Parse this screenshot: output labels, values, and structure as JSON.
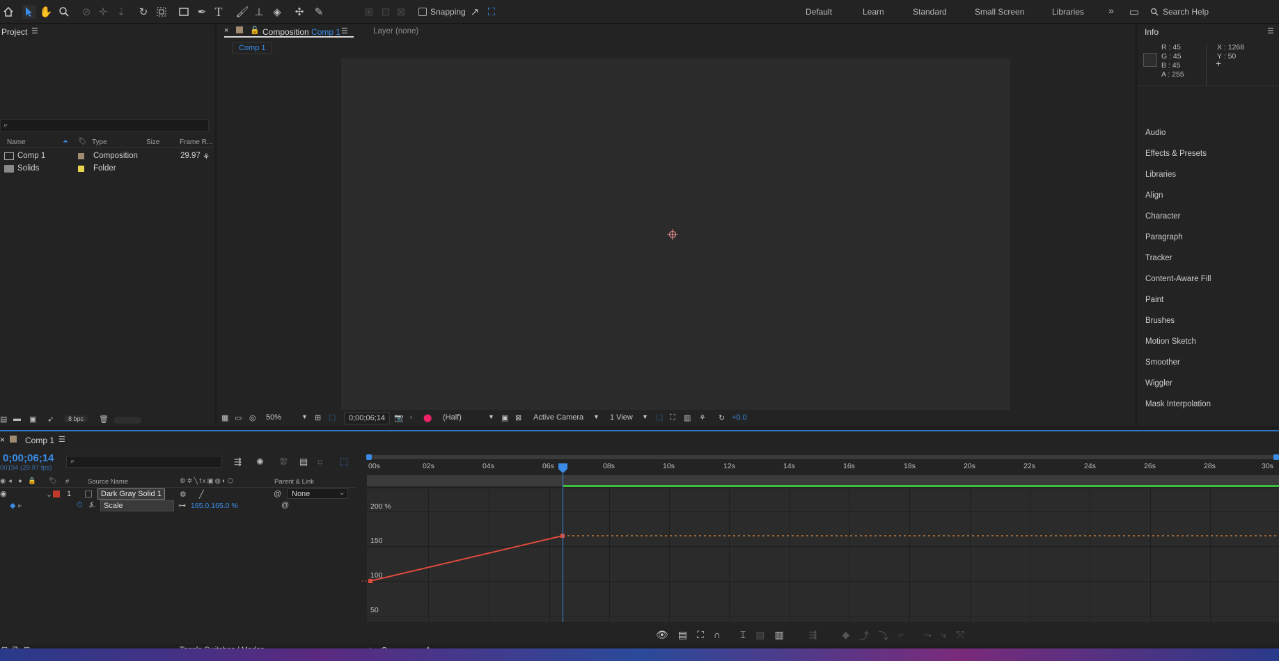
{
  "toolbar": {
    "snapping_label": "Snapping",
    "workspaces": [
      "Default",
      "Learn",
      "Standard",
      "Small Screen",
      "Libraries"
    ],
    "search_label": "Search Help"
  },
  "project": {
    "title": "Project",
    "columns": [
      "Name",
      "Type",
      "Size",
      "Frame R..."
    ],
    "items": [
      {
        "name": "Comp 1",
        "type": "Composition",
        "frame_rate": "29.97",
        "swatch": "#a08a70"
      },
      {
        "name": "Solids",
        "type": "Folder",
        "frame_rate": "",
        "swatch": "#e8d44d"
      }
    ],
    "bpc": "8 bpc"
  },
  "composition": {
    "tab_prefix": "Composition",
    "tab_name": "Comp 1",
    "layer_tab": "Layer  (none)",
    "breadcrumb": "Comp 1",
    "zoom": "50%",
    "timecode": "0;00;06;14",
    "resolution": "(Half)",
    "camera": "Active Camera",
    "views": "1 View",
    "exposure": "+0.0"
  },
  "info": {
    "title": "Info",
    "r": "R :  45",
    "g": "G :  45",
    "b": "B :  45",
    "a": "A :  255",
    "x": "X : 1268",
    "y": "Y : 50"
  },
  "right_panels": [
    "Audio",
    "Effects & Presets",
    "Libraries",
    "Align",
    "Character",
    "Paragraph",
    "Tracker",
    "Content-Aware Fill",
    "Paint",
    "Brushes",
    "Motion Sketch",
    "Smoother",
    "Wiggler",
    "Mask Interpolation"
  ],
  "timeline": {
    "tab": "Comp 1",
    "timecode": "0;00;06;14",
    "frames": "00194 (29.97 fps)",
    "col_num": "#",
    "col_source": "Source Name",
    "col_parent": "Parent & Link",
    "layer_num": "1",
    "layer_name": "Dark Gray Solid 1",
    "parent_value": "None",
    "prop_name": "Scale",
    "prop_value": "165.0,165.0 %",
    "toggle_label": "Toggle Switches / Modes",
    "ruler": [
      "00s",
      "02s",
      "04s",
      "06s",
      "08s",
      "10s",
      "12s",
      "14s",
      "16s",
      "18s",
      "20s",
      "22s",
      "24s",
      "26s",
      "28s",
      "30s"
    ],
    "y_labels": [
      "200 %",
      "150",
      "100",
      "50"
    ]
  },
  "colors": {
    "accent": "#2c8ae8",
    "layer_label": "#c0392b",
    "curve": "#e04a3a",
    "work_area": "#3dbf3d"
  }
}
